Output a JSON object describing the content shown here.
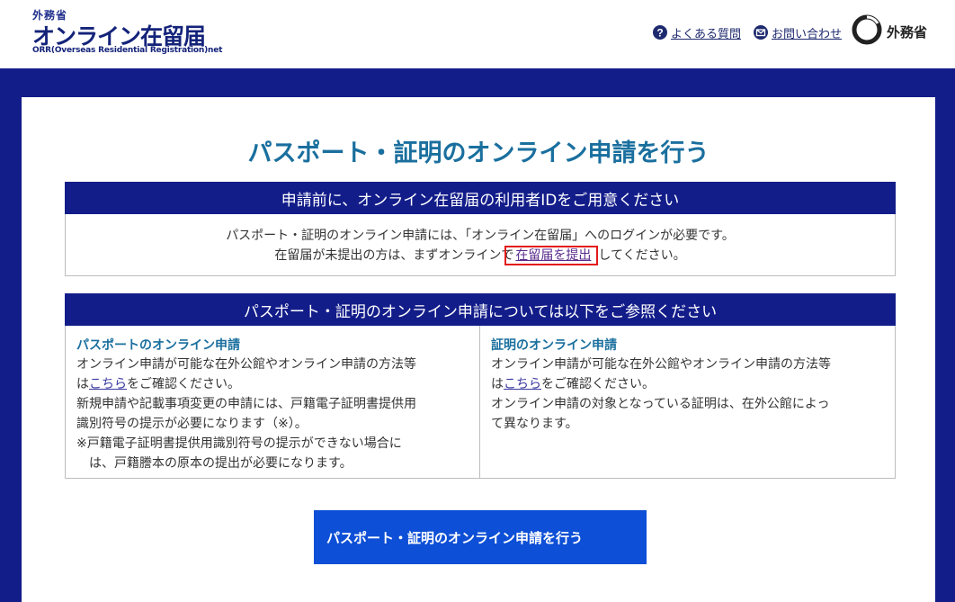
{
  "header": {
    "logo_top": "外務省",
    "logo_main": "オンライン在留届",
    "logo_sub": "ORR(Overseas Residential Registration)net",
    "faq_label": "よくある質問",
    "contact_label": "お問い合わせ",
    "ministry_label": "外務省"
  },
  "page": {
    "title": "パスポート・証明のオンライン申請を行う"
  },
  "notice": {
    "heading": "申請前に、オンライン在留届の利用者IDをご用意ください",
    "line1": "パスポート・証明のオンライン申請には、「オンライン在留届」へのログインが必要です。",
    "line2_before": "在留届が未提出の方は、まずオンラインで",
    "line2_link": "在留届を提出",
    "line2_after": "してください。"
  },
  "info": {
    "heading": "パスポート・証明のオンライン申請については以下をご参照ください",
    "passport": {
      "title": "パスポートのオンライン申請",
      "p1": "オンライン申請が可能な在外公館やオンライン申請の方法等",
      "p2_before": "は",
      "p2_link": "こちら",
      "p2_after": "をご確認ください。",
      "p3": "新規申請や記載事項変更の申請には、戸籍電子証明書提供用",
      "p4": "識別符号の提示が必要になります（※）。",
      "note1": "※戸籍電子証明書提供用識別符号の提示ができない場合に",
      "note2": "は、戸籍謄本の原本の提出が必要になります。"
    },
    "certificate": {
      "title": "証明のオンライン申請",
      "p1": "オンライン申請が可能な在外公館やオンライン申請の方法等",
      "p2_before": "は",
      "p2_link": "こちら",
      "p2_after": "をご確認ください。",
      "p3": "オンライン申請の対象となっている証明は、在外公館によっ",
      "p4": "て異なります。"
    }
  },
  "cta_label": "パスポート・証明のオンライン申請を行う",
  "colors": {
    "navy": "#131d8a",
    "title_blue": "#1a6f9e",
    "button_blue": "#0d4fd6",
    "highlight_red": "#e31b1b"
  }
}
